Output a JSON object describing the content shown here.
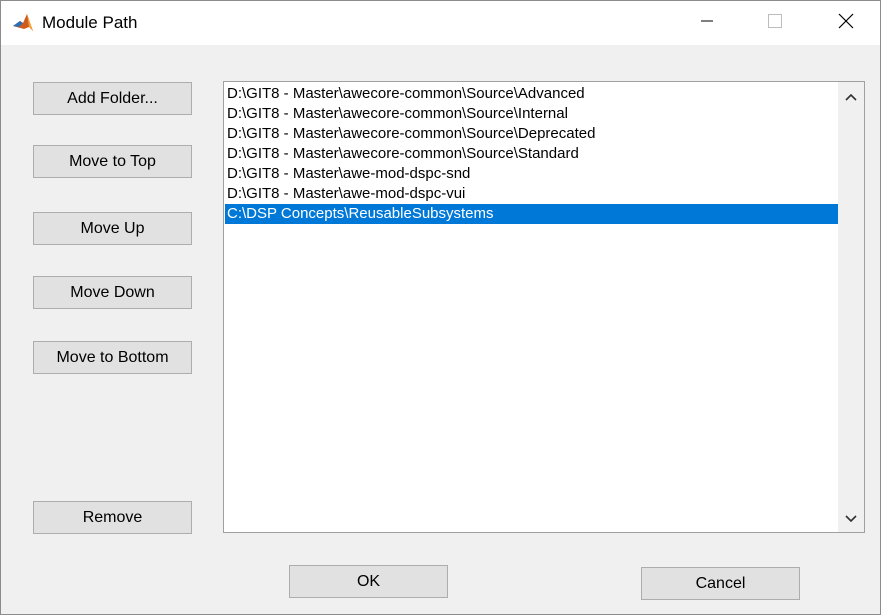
{
  "window": {
    "title": "Module Path",
    "icon": "matlab-icon",
    "controls": [
      "minimize-icon",
      "maximize-icon",
      "close-icon"
    ]
  },
  "buttons": {
    "add_folder": "Add Folder...",
    "move_to_top": "Move to Top",
    "move_up": "Move Up",
    "move_down": "Move Down",
    "move_to_bottom": "Move to Bottom",
    "remove": "Remove",
    "ok": "OK",
    "cancel": "Cancel"
  },
  "paths": {
    "items": [
      "D:\\GIT8 - Master\\awecore-common\\Source\\Advanced",
      "D:\\GIT8 - Master\\awecore-common\\Source\\Internal",
      "D:\\GIT8 - Master\\awecore-common\\Source\\Deprecated",
      "D:\\GIT8 - Master\\awecore-common\\Source\\Standard",
      "D:\\GIT8 - Master\\awe-mod-dspc-snd",
      "D:\\GIT8 - Master\\awe-mod-dspc-vui",
      "C:\\DSP Concepts\\ReusableSubsystems"
    ],
    "selected_index": 6
  },
  "colors": {
    "selection": "#0078d7",
    "dialog_background": "#f0f0f0",
    "button_face": "#e1e1e1"
  }
}
